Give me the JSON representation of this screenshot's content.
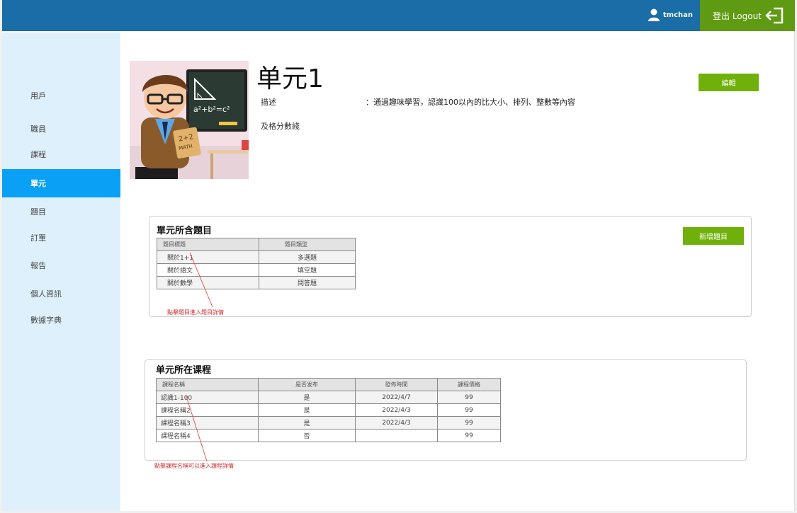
{
  "header": {
    "username": "tmchan",
    "logout_label": "登出 Logout"
  },
  "sidebar": {
    "items": [
      {
        "label": "用戶"
      },
      {
        "label": "職員"
      },
      {
        "label": "課程"
      },
      {
        "label": "單元"
      },
      {
        "label": "題目"
      },
      {
        "label": "訂單"
      },
      {
        "label": "報告"
      },
      {
        "label": "個人資訊"
      },
      {
        "label": "數據字典"
      }
    ],
    "active": "單元"
  },
  "unit": {
    "title": "单元1",
    "edit_label": "編輯",
    "desc_label": "描述",
    "desc_text": "：通過趣味學習，認識100以內的比大小、排列、整數等內容",
    "desc_line2": "及格分數綫"
  },
  "questions_panel": {
    "title": "單元所含題目",
    "add_label": "新增題目",
    "headers": [
      "題目標題",
      "題目類型"
    ],
    "rows": [
      [
        "關於1+1",
        "多選題"
      ],
      [
        "關於語文",
        "填空題"
      ],
      [
        "關於數學",
        "問答題"
      ]
    ],
    "note": "點擊題目進入題目詳情"
  },
  "courses_panel": {
    "title": "单元所在课程",
    "headers": [
      "課程名稱",
      "是否发布",
      "發佈時間",
      "課程價格"
    ],
    "rows": [
      [
        "認識1-100",
        "是",
        "2022/4/7",
        "99"
      ],
      [
        "課程名稱2",
        "是",
        "2022/4/3",
        "99"
      ],
      [
        "課程名稱3",
        "是",
        "2022/4/3",
        "99"
      ],
      [
        "課程名稱4",
        "否",
        "",
        "99"
      ]
    ],
    "note": "點擊課程名稱可以進入課程詳情"
  },
  "avatar_art": {
    "board_text_1": "a²+b²=c²",
    "book_text_1": "2+2",
    "book_text_2": "MATH"
  }
}
